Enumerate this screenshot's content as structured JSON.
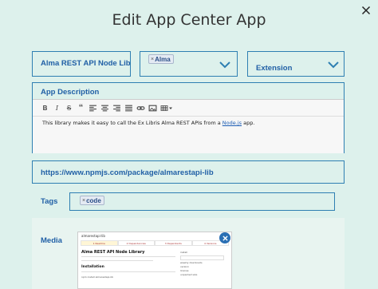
{
  "dialog": {
    "title": "Edit App Center App",
    "close_icon": "close-icon"
  },
  "app_name": {
    "value": "Alma REST API Node Libr"
  },
  "product_select": {
    "chip_label": "Alma",
    "chip_remove": "×",
    "chevron_icon": "chevron-down-icon"
  },
  "category_select": {
    "value": "Extension",
    "chevron_icon": "chevron-down-icon"
  },
  "description": {
    "label": "App Description",
    "toolbar": {
      "bold": "B",
      "italic": "I",
      "strike": "S",
      "quote": "“",
      "icons": [
        "bold-icon",
        "italic-icon",
        "strikethrough-icon",
        "blockquote-icon",
        "align-left-icon",
        "align-center-icon",
        "align-right-icon",
        "align-justify-icon",
        "link-icon",
        "image-icon",
        "table-icon"
      ]
    },
    "text_before": "This library makes it easy to call the Ex Libris Alma REST APIs from a ",
    "link_text": "Node.js",
    "text_after": " app."
  },
  "url": {
    "value": "https://www.npmjs.com/package/almarestapi-lib"
  },
  "tags": {
    "label": "Tags",
    "chip_label": "code",
    "chip_remove": "×"
  },
  "media": {
    "label": "Media",
    "thumbnail": {
      "header": "almarestapi-lib",
      "tabs": [
        "1 Readme",
        "2 Dependencies",
        "3 Dependents",
        "4 Versions"
      ],
      "title": "Alma REST API Node Library",
      "install": "Installation",
      "code": "npm install almarestapi-lib",
      "side": [
        "install",
        "weekly downloads",
        "version",
        "license",
        "unpacked size"
      ],
      "remove_icon": "close-icon"
    }
  },
  "colors": {
    "background": "#ddf1ec",
    "accent": "#2e7fb2",
    "text_blue": "#2160a6"
  }
}
